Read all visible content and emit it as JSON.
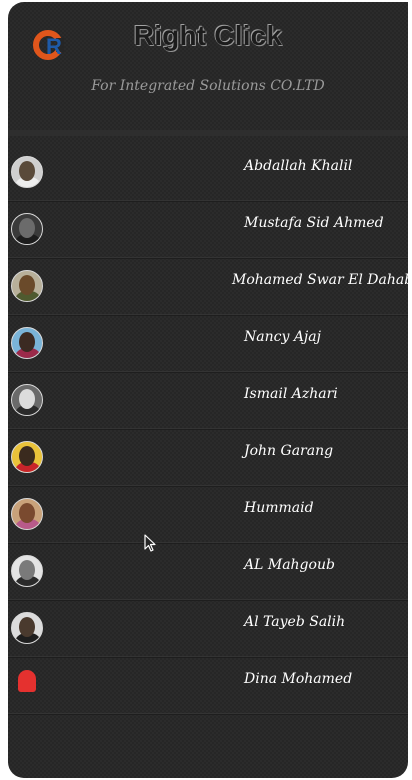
{
  "header": {
    "title": "Right Click",
    "subtitle": "For Integrated Solutions CO.LTD",
    "logo_letter": "R"
  },
  "contacts": [
    {
      "name": "Abdallah Khalil",
      "avatar_bg": "#cfcfcf",
      "face": "#5a4a3a",
      "body": "#eeeeee"
    },
    {
      "name": "Mustafa Sid Ahmed",
      "avatar_bg": "#3a3a3a",
      "face": "#6b6b6b",
      "body": "#1c1c1c"
    },
    {
      "name": "Mohamed Swar El Dahab",
      "avatar_bg": "#b8b09a",
      "face": "#6a4a2a",
      "body": "#4f5a2f"
    },
    {
      "name": "Nancy Ajaj",
      "avatar_bg": "#7ab4d8",
      "face": "#3b2a22",
      "body": "#9b2a4a"
    },
    {
      "name": "Ismail Azhari",
      "avatar_bg": "#6a6a6a",
      "face": "#dcdcdc",
      "body": "#2a2a2a"
    },
    {
      "name": "John Garang",
      "avatar_bg": "#e9c23a",
      "face": "#3a2a1e",
      "body": "#c8242a"
    },
    {
      "name": "Hummaid",
      "avatar_bg": "#c9a27a",
      "face": "#7a4a2f",
      "body": "#b85a8a"
    },
    {
      "name": "AL Mahgoub",
      "avatar_bg": "#e4e4e4",
      "face": "#7a7a7a",
      "body": "#2a2a2a"
    },
    {
      "name": "Al Tayeb Salih",
      "avatar_bg": "#dcdcdc",
      "face": "#4a3a2e",
      "body": "#1e1e1e"
    },
    {
      "name": "Dina Mohamed",
      "avatar_bg": "#262626",
      "face": "#e5312f",
      "body": "#e5312f"
    }
  ],
  "colors": {
    "background": "#262626",
    "text": "#ffffff",
    "subtitle": "#9a9a9a",
    "logo_orange": "#e0561c",
    "logo_blue": "#1e5aa8"
  }
}
